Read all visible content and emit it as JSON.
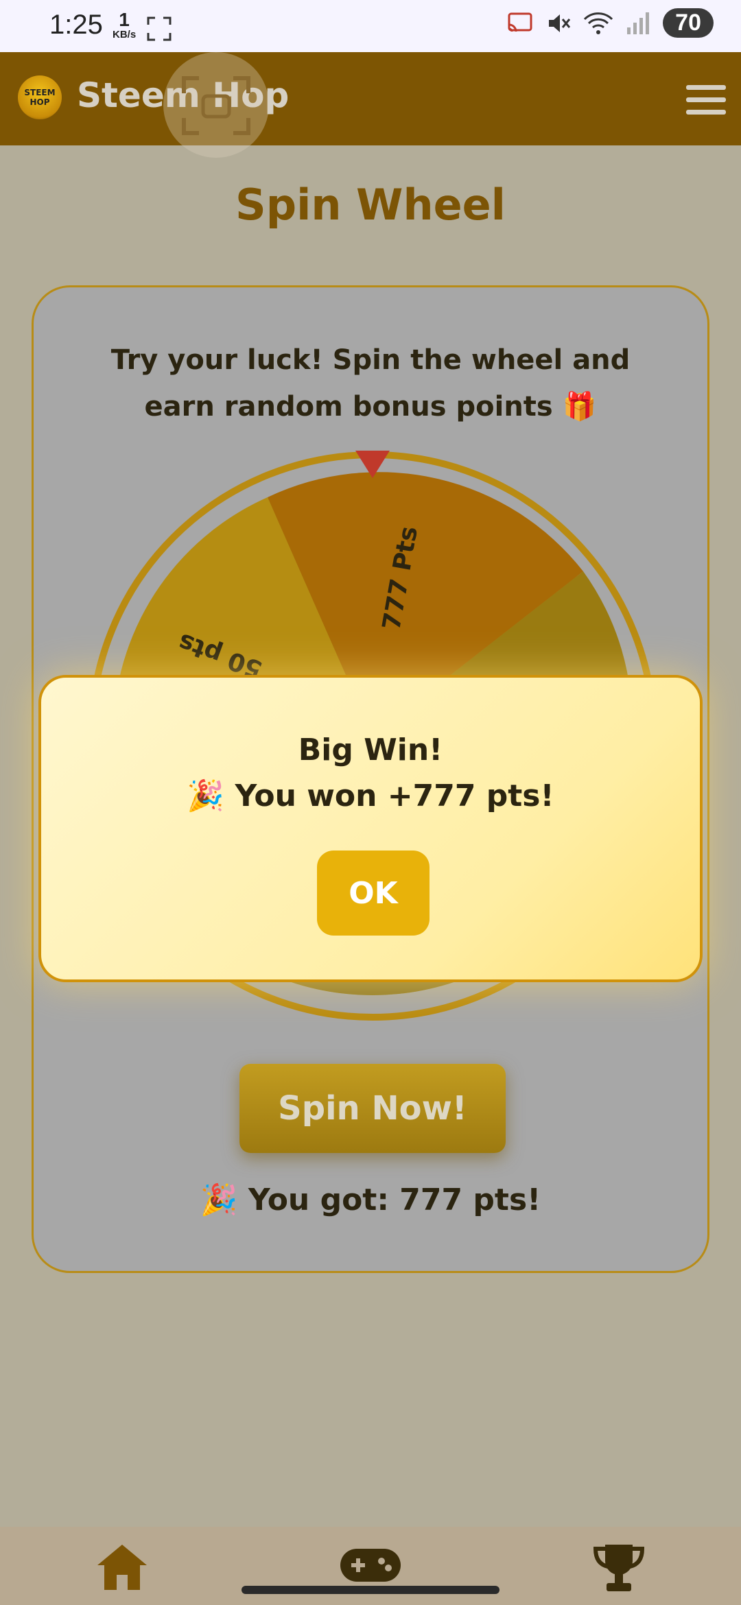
{
  "status_bar": {
    "time": "1:25",
    "speed_value": "1",
    "speed_unit": "KB/s",
    "battery": "70"
  },
  "header": {
    "logo_text": "STEEM HOP",
    "app_title": "Steem Hop"
  },
  "page": {
    "title": "Spin Wheel",
    "intro": "Try your luck! Spin the wheel and earn random bonus points 🎁",
    "wheel_labels": [
      "777 Pts",
      "50 pts"
    ],
    "spin_button": "Spin Now!",
    "result": "🎉 You got: 777 pts!"
  },
  "dialog": {
    "title": "Big Win!",
    "message": "🎉 You won +777 pts!",
    "ok": "OK"
  },
  "colors": {
    "accent": "#e8b20a",
    "header": "#7d5503",
    "title": "#7c5405"
  },
  "icons": [
    "fullscreen-icon",
    "cast-icon",
    "mute-icon",
    "wifi-icon",
    "signal-icon",
    "menu-icon",
    "home-icon",
    "gamepad-icon",
    "trophy-icon"
  ]
}
